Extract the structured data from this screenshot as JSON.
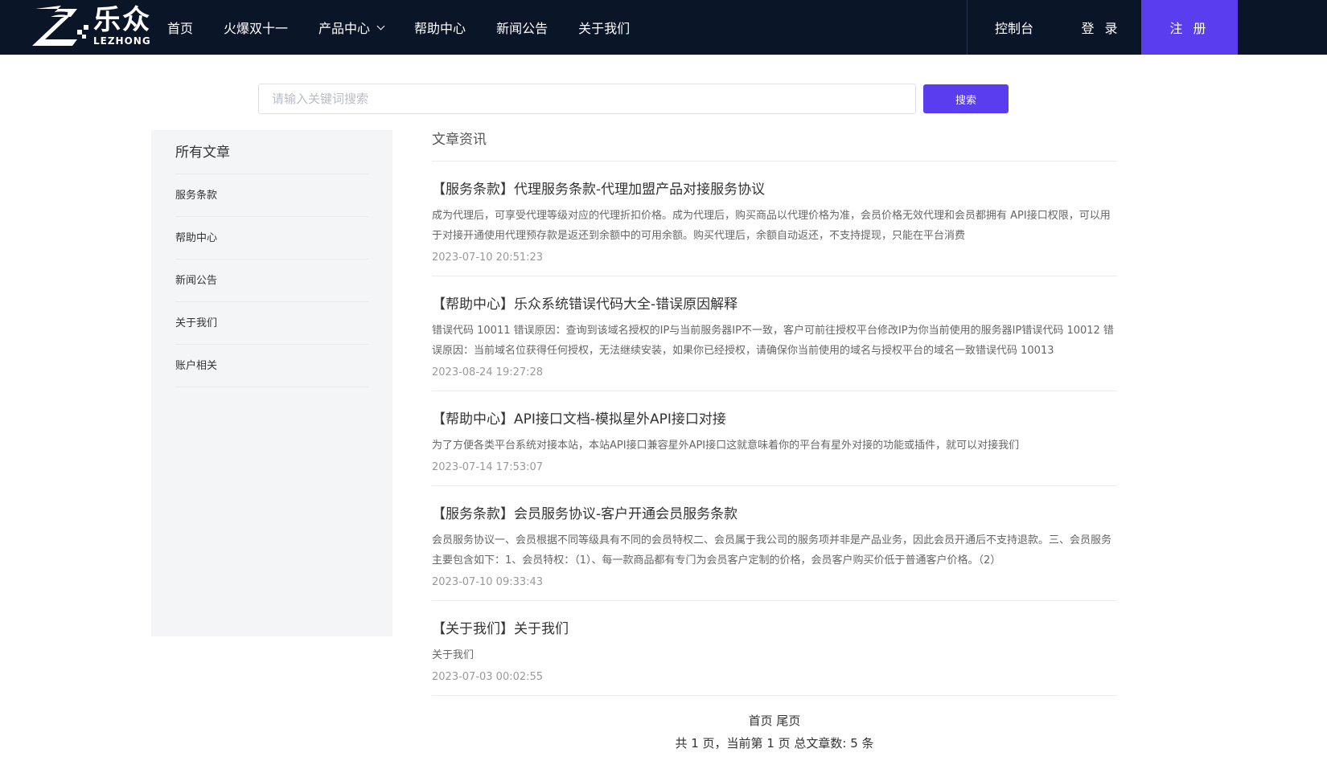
{
  "brand": {
    "name_cn": "乐众",
    "name_en": "LEZHONG"
  },
  "nav": {
    "items": [
      {
        "label": "首页"
      },
      {
        "label": "火爆双十一"
      },
      {
        "label": "产品中心",
        "has_dropdown": true
      },
      {
        "label": "帮助中心"
      },
      {
        "label": "新闻公告"
      },
      {
        "label": "关于我们"
      }
    ]
  },
  "header_right": {
    "console": "控制台",
    "login": "登 录",
    "register": "注 册"
  },
  "search": {
    "placeholder": "请输入关键词搜索",
    "value": "",
    "button": "搜索"
  },
  "sidebar": {
    "title": "所有文章",
    "items": [
      {
        "label": "服务条款"
      },
      {
        "label": "帮助中心"
      },
      {
        "label": "新闻公告"
      },
      {
        "label": "关于我们"
      },
      {
        "label": "账户相关"
      }
    ]
  },
  "main": {
    "title": "文章资讯",
    "articles": [
      {
        "title": "【服务条款】代理服务条款-代理加盟产品对接服务协议",
        "desc": "成为代理后，可享受代理等级对应的代理折扣价格。成为代理后，购买商品以代理价格为准，会员价格无效代理和会员都拥有 API接口权限，可以用于对接开通使用代理预存款是返还到余额中的可用余额。购买代理后，余额自动返还，不支持提现，只能在平台消费",
        "date": "2023-07-10 20:51:23"
      },
      {
        "title": "【帮助中心】乐众系统错误代码大全-错误原因解释",
        "desc": "错误代码 10011 错误原因：查询到该域名授权的IP与当前服务器IP不一致，客户可前往授权平台修改IP为你当前使用的服务器IP错误代码 10012 错误原因：当前域名位获得任何授权，无法继续安装，如果你已经授权，请确保你当前使用的域名与授权平台的域名一致错误代码 10013",
        "date": "2023-08-24 19:27:28"
      },
      {
        "title": "【帮助中心】API接口文档-模拟星外API接口对接",
        "desc": "为了方便各类平台系统对接本站，本站API接口兼容星外API接口这就意味着你的平台有星外对接的功能或插件，就可以对接我们",
        "date": "2023-07-14 17:53:07"
      },
      {
        "title": "【服务条款】会员服务协议-客户开通会员服务条款",
        "desc": "会员服务协议一、会员根据不同等级具有不同的会员特权二、会员属于我公司的服务项并非是产品业务，因此会员开通后不支持退款。三、会员服务主要包含如下：1、会员特权：（1）、每一款商品都有专门为会员客户定制的价格，会员客户购买价低于普通客户价格。（2）",
        "date": "2023-07-10 09:33:43"
      },
      {
        "title": "【关于我们】关于我们",
        "desc": "关于我们",
        "date": "2023-07-03 00:02:55"
      }
    ]
  },
  "pager": {
    "first": "首页",
    "last": "尾页",
    "info": "共 1 页，当前第 1 页   总文章数: 5 条"
  }
}
